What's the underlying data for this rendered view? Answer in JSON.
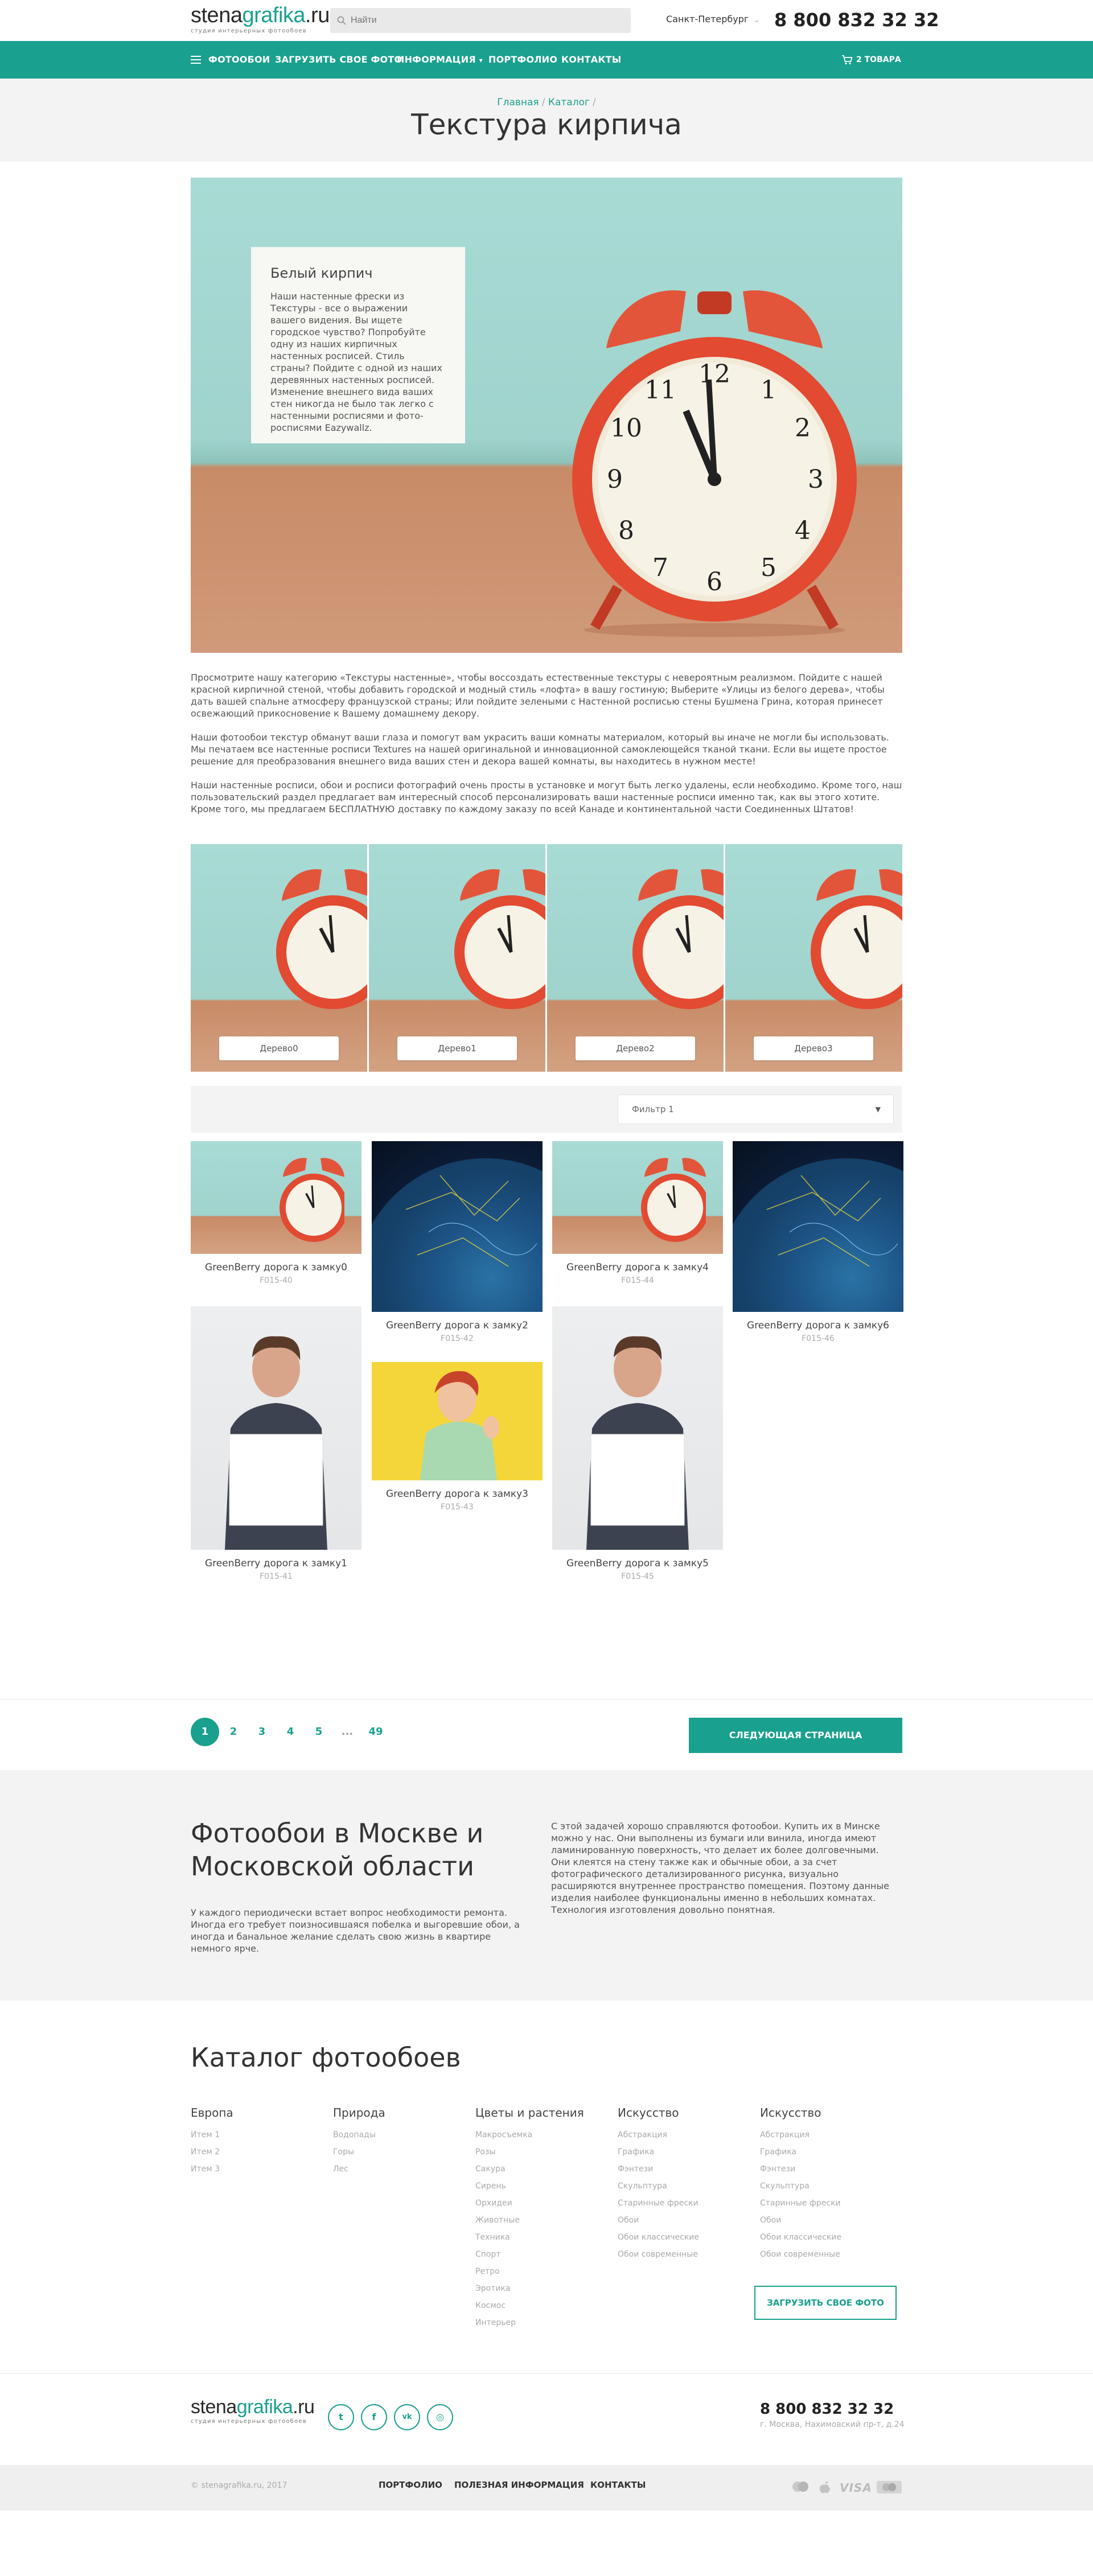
{
  "header": {
    "logo_dark": "stena",
    "logo_green": "grafika",
    "logo_tld": ".ru",
    "logo_sub": "студия интерьерных фотообоев",
    "search_placeholder": "Найти",
    "city": "Санкт-Петербург",
    "phone": "8 800 832 32 32"
  },
  "nav": {
    "items": [
      "Фотообои",
      "Загрузить свое фото",
      "Информация",
      "Портфолио",
      "Контакты"
    ],
    "cart_label": "2 товара"
  },
  "breadcrumb": [
    "Главная",
    "Каталог"
  ],
  "page_title": "Текстура кирпича",
  "hero": {
    "card_title": "Белый кирпич",
    "card_text": "Наши настенные фрески из Текстуры - все о выражении вашего видения. Вы ищете городское чувство? Попробуйте одну из наших кирпичных настенных росписей. Стиль страны? Пойдите с одной из наших деревянных настенных росписей. Изменение внешнего вида ваших стен никогда не было так легко с настенными росписями и фото-росписями Eazywallz."
  },
  "description": [
    "Просмотрите нашу категорию «Текстуры настенные», чтобы воссоздать естественные текстуры с невероятным реализмом. Пойдите с нашей красной кирпичной стеной, чтобы добавить городской и модный стиль «лофта» в вашу гостиную; Выберите «Улицы из белого дерева», чтобы дать вашей спальне атмосферу французской страны; Или пойдите зелеными с Настенной росписью стены Бушмена Грина, которая принесет освежающий прикосновение к Вашему домашнему декору.",
    "Наши фотообои текстур обманут ваши глаза и помогут вам украсить ваши комнаты материалом, который вы иначе не могли бы использовать. Мы печатаем все настенные росписи Textures на нашей оригинальной и инновационной самоклеющейся тканой ткани. Если вы ищете простое решение для преобразования внешнего вида ваших стен и декора вашей комнаты, вы находитесь в нужном месте!",
    "Наши настенные росписи, обои и росписи фотографий очень просты в установке и могут быть легко удалены, если необходимо. Кроме того, наш пользовательский раздел предлагает вам интересный способ персонализировать ваши настенные росписи именно так, как вы этого хотите. Кроме того, мы предлагаем БЕСПЛАТНУЮ доставку по каждому заказу по всей Канаде и континентальной части Соединенных Штатов!"
  ],
  "gallery": [
    "Дерево0",
    "Дерево1",
    "Дерево2",
    "Дерево3"
  ],
  "filter": {
    "selected": "Фильтр 1"
  },
  "products": [
    {
      "name": "GreenBerry дорога к замку0",
      "code": "F015-40"
    },
    {
      "name": "GreenBerry дорога к замку1",
      "code": "F015-41"
    },
    {
      "name": "GreenBerry дорога к замку2",
      "code": "F015-42"
    },
    {
      "name": "GreenBerry дорога к замку3",
      "code": "F015-43"
    },
    {
      "name": "GreenBerry дорога к замку4",
      "code": "F015-44"
    },
    {
      "name": "GreenBerry дорога к замку5",
      "code": "F015-45"
    },
    {
      "name": "GreenBerry дорога к замку6",
      "code": "F015-46"
    }
  ],
  "pagination": {
    "pages": [
      "1",
      "2",
      "3",
      "4",
      "5",
      "...",
      "49"
    ],
    "next_label": "Следующая страница"
  },
  "seo": {
    "title": "Фотообои в Москве и Московской области",
    "left_text": "У каждого периодически встает вопрос необходимости ремонта. Иногда его требует поизносившаяся побелка и выгоревшие обои, а иногда и банальное желание сделать свою жизнь в квартире немного ярче.",
    "right_text": "С этой задачей хорошо справляются фотообои. Купить их в Минске можно у нас. Они выполнены из бумаги или винила, иногда имеют ламинированную поверхность, что делает их более долговечными. Они клеятся на стену также как и обычные обои, а за счет фотографического детализированного рисунка, визуально расширяются внутреннее пространство помещения. Поэтому данные изделия наиболее функциональны именно в небольших комнатах. Технология изготовления довольно понятная."
  },
  "catalog": {
    "title": "Каталог фотообоев",
    "columns": [
      {
        "head": "Европа",
        "items": [
          "Итем 1",
          "Итем 2",
          "Итем 3"
        ]
      },
      {
        "head": "Природа",
        "items": [
          "Водопады",
          "Горы",
          "Лес"
        ]
      },
      {
        "head": "Цветы и растения",
        "items": [
          "Макросъемка",
          "Розы",
          "Сакура",
          "Сирень",
          "Орхидеи",
          "Животные",
          "Техника",
          "Спорт",
          "Ретро",
          "Эротика",
          "Космос",
          "Интерьер"
        ]
      },
      {
        "head": "Искусство",
        "items": [
          "Абстракция",
          "Графика",
          "Фэнтези",
          "Скульптура",
          "Старинные фрески",
          "Обои",
          "Обои классические",
          "Обои современные"
        ]
      },
      {
        "head": "Искусство",
        "items": [
          "Абстракция",
          "Графика",
          "Фэнтези",
          "Скульптура",
          "Старинные фрески",
          "Обои",
          "Обои классические",
          "Обои современные"
        ]
      }
    ],
    "upload_label": "Загрузить свое фото"
  },
  "footer": {
    "phone": "8 800 832 32 32",
    "address": "г. Москва, Нахимовский пр-т, д.24",
    "copyright": "© stenagrafika.ru, 2017",
    "nav": [
      "Портфолио",
      "Полезная информация",
      "Контакты"
    ],
    "social_icons": [
      "twitter-icon",
      "facebook-icon",
      "vk-icon",
      "instagram-icon"
    ],
    "payments": [
      "mastercard-icon",
      "applepay-icon",
      "visa-icon",
      "maestro-icon"
    ]
  },
  "colors": {
    "accent": "#1aa08e",
    "light_bg": "#f3f3f3"
  }
}
